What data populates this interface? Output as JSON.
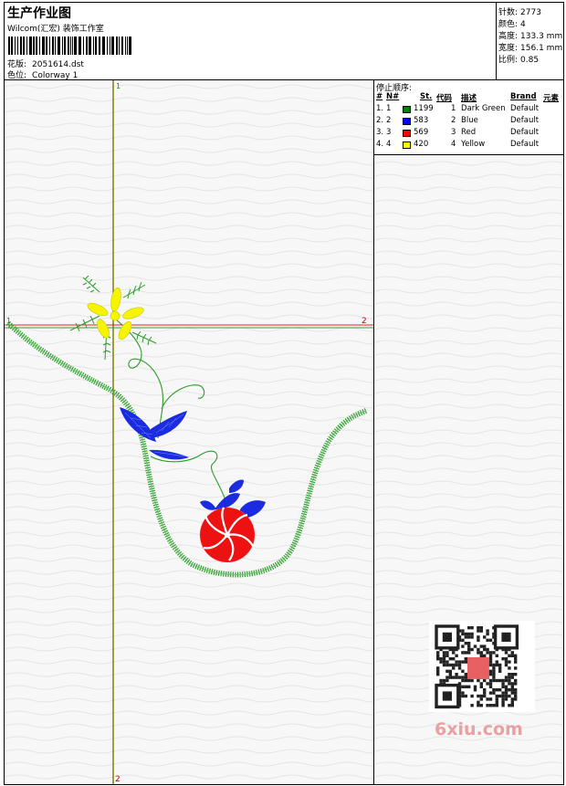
{
  "header": {
    "title": "生产作业图",
    "subtitle": "Wilcom(汇宏) 装饰工作室",
    "design_label": "花版:",
    "design_value": "2051614.dst",
    "colorway_label": "色位:",
    "colorway_value": "Colorway 1"
  },
  "stats": [
    {
      "label": "针数:",
      "value": "2773"
    },
    {
      "label": "颜色:",
      "value": "4"
    },
    {
      "label": "高度:",
      "value": "133.3 mm"
    },
    {
      "label": "宽度:",
      "value": "156.1 mm"
    },
    {
      "label": "比例:",
      "value": "0.85"
    }
  ],
  "stop_sequence": {
    "title": "停止顺序:",
    "columns": [
      "#",
      "N#",
      "St.",
      "代码",
      "描述",
      "Brand",
      "元素"
    ],
    "rows": [
      {
        "num": "1.",
        "n": "1",
        "color": "#008000",
        "stitches": "1199",
        "code": "1",
        "desc": "Dark Green",
        "brand": "Default"
      },
      {
        "num": "2.",
        "n": "2",
        "color": "#0000ff",
        "stitches": "583",
        "code": "2",
        "desc": "Blue",
        "brand": "Default"
      },
      {
        "num": "3.",
        "n": "3",
        "color": "#ff0000",
        "stitches": "569",
        "code": "3",
        "desc": "Red",
        "brand": "Default"
      },
      {
        "num": "4.",
        "n": "4",
        "color": "#ffff00",
        "stitches": "420",
        "code": "4",
        "desc": "Yellow",
        "brand": "Default"
      }
    ]
  },
  "markers": {
    "vertical_top": "1",
    "vertical_bottom": "2",
    "horizontal_left": "1",
    "horizontal_right": "2"
  },
  "watermark": "6xiu.com",
  "colors": {
    "green": "#2e9a2e",
    "blue": "#1a2be0",
    "red": "#ee1111",
    "yellow": "#f2f200",
    "vertical_guide": "#808000",
    "horizontal_guide": "#ff0000"
  }
}
